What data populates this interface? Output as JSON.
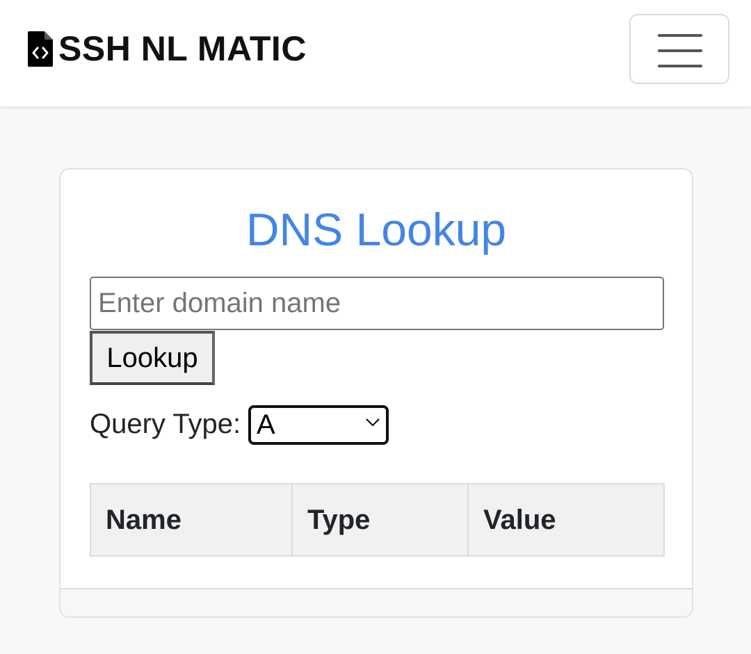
{
  "navbar": {
    "brand_icon": "file-code-icon",
    "brand_text": "SSH NL MATIC",
    "toggler_icon": "hamburger-menu-icon"
  },
  "card": {
    "title": "DNS Lookup",
    "title_color": "#4285e6",
    "domain_input": {
      "value": "",
      "placeholder": "Enter domain name"
    },
    "lookup_button_label": "Lookup",
    "query_type_label": "Query Type:",
    "query_type_selected": "A",
    "query_type_icon": "chevron-down-icon",
    "table": {
      "columns": [
        "Name",
        "Type",
        "Value"
      ],
      "rows": []
    }
  }
}
